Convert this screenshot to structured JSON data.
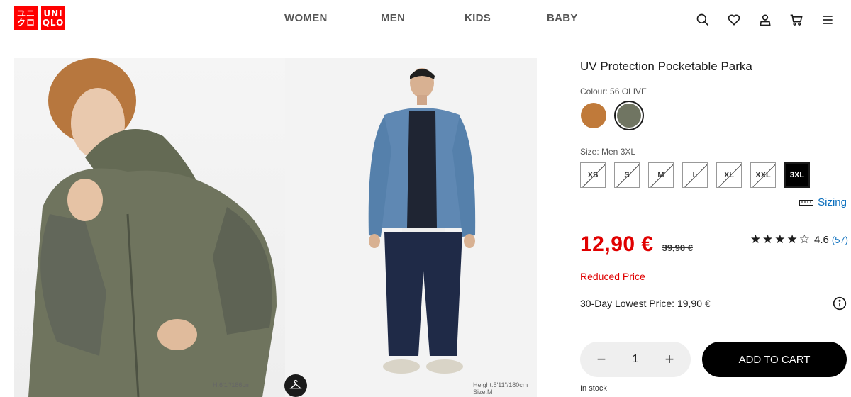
{
  "brand": {
    "logo_top": "UNI",
    "logo_bottom": "QLO",
    "logo_kana_top": "ユニ",
    "logo_kana_bottom": "クロ",
    "color": "#ff0000"
  },
  "nav": {
    "items": [
      "WOMEN",
      "MEN",
      "KIDS",
      "BABY"
    ]
  },
  "header_icons": [
    "search-icon",
    "heart-icon",
    "account-icon",
    "cart-icon",
    "menu-icon"
  ],
  "gallery": {
    "caption_left": "H:6'1\"/186cm",
    "caption_left_2": "",
    "caption_right": "Height:5'11\"/180cm",
    "caption_right_2": "Size:M"
  },
  "product": {
    "title": "UV Protection Pocketable Parka",
    "colour_label": "Colour: 56 OLIVE",
    "swatches": [
      {
        "name": "brown",
        "color": "#c07a3a",
        "selected": false
      },
      {
        "name": "olive",
        "color": "#707562",
        "selected": true
      }
    ],
    "size_label": "Size: Men 3XL",
    "sizes": [
      "XS",
      "S",
      "M",
      "L",
      "XL",
      "XXL",
      "3XL"
    ],
    "selected_size": "3XL",
    "sizing_label": "Sizing",
    "price": "12,90 €",
    "old_price": "39,90 €",
    "rating_stars": "★★★★☆",
    "rating_value": "4.6",
    "rating_count": "(57)",
    "reduced_label": "Reduced Price",
    "lowest_price": "30-Day Lowest Price: 19,90 €",
    "quantity": "1",
    "add_to_cart": "ADD TO CART",
    "stock": "In stock",
    "accent_red": "#e00000",
    "link_blue": "#0a6ebd"
  }
}
